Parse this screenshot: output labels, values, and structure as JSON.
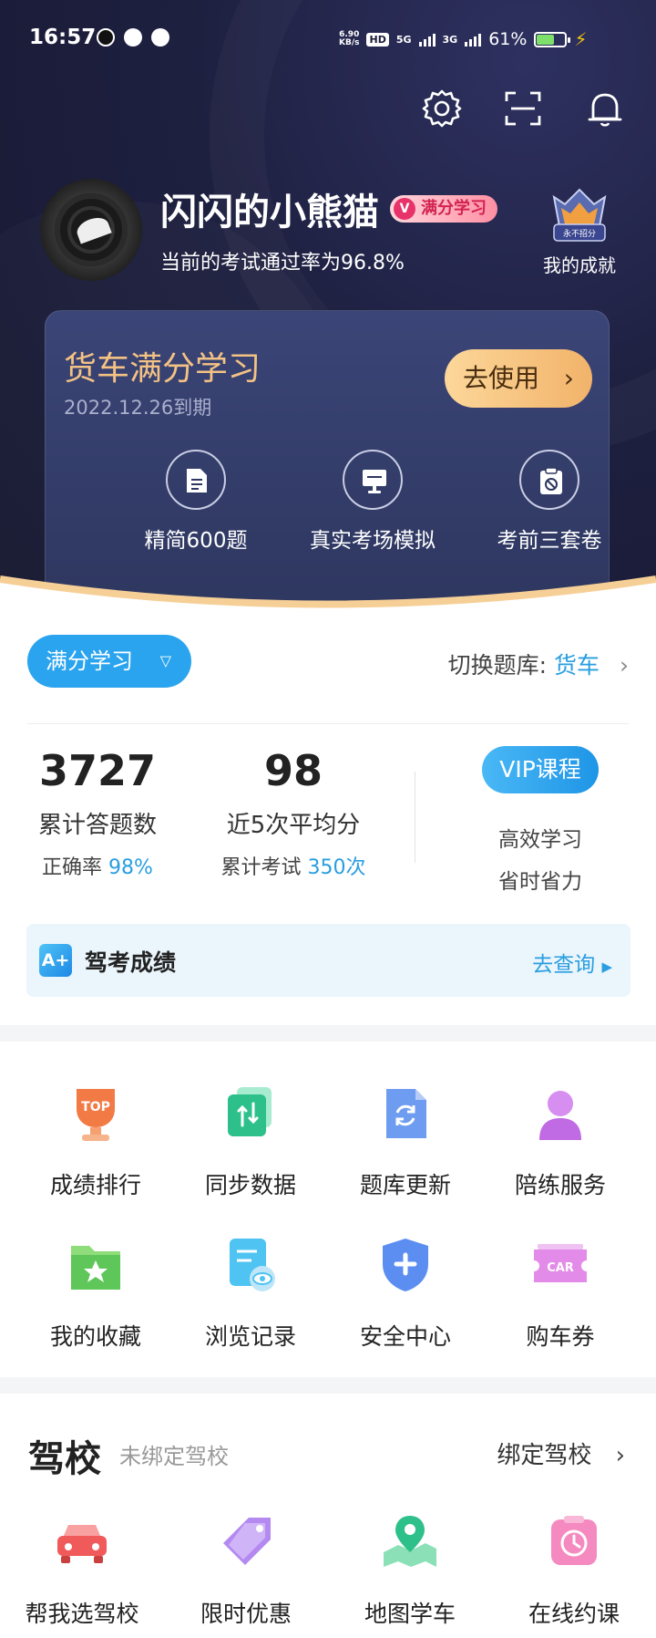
{
  "status_bar": {
    "time": "16:57",
    "net_speed": "6.90",
    "net_unit": "KB/s",
    "hd": "HD",
    "sig1": "5G",
    "sig2": "3G",
    "battery": "61%"
  },
  "header_icons": [
    "gear-icon",
    "scan-icon",
    "bell-icon"
  ],
  "profile": {
    "username": "闪闪的小熊猫",
    "badge": "满分学习",
    "pass_rate_text": "当前的考试通过率为96.8%",
    "achievement_label": "我的成就",
    "achievement_ribbon": "永不招分"
  },
  "plan_card": {
    "title": "货车满分学习",
    "expiry": "2022.12.26到期",
    "use_button": "去使用",
    "features": [
      {
        "label": "精简600题",
        "icon": "document-icon"
      },
      {
        "label": "真实考场模拟",
        "icon": "monitor-icon"
      },
      {
        "label": "考前三套卷",
        "icon": "clipboard-icon"
      }
    ]
  },
  "mode": {
    "selector": "满分学习",
    "switch_label": "切换题库:",
    "switch_value": "货车"
  },
  "stats": {
    "answered": {
      "value": "3727",
      "label": "累计答题数",
      "sub_label": "正确率",
      "sub_value": "98%"
    },
    "average": {
      "value": "98",
      "label": "近5次平均分",
      "sub_label": "累计考试",
      "sub_value": "350次"
    },
    "vip": {
      "button": "VIP课程",
      "line1": "高效学习",
      "line2": "省时省力"
    }
  },
  "results": {
    "badge": "A+",
    "label": "驾考成绩",
    "action": "去查询"
  },
  "tools": [
    {
      "label": "成绩排行",
      "icon": "trophy-icon"
    },
    {
      "label": "同步数据",
      "icon": "sync-icon"
    },
    {
      "label": "题库更新",
      "icon": "refresh-icon"
    },
    {
      "label": "陪练服务",
      "icon": "coach-icon"
    },
    {
      "label": "我的收藏",
      "icon": "star-folder-icon"
    },
    {
      "label": "浏览记录",
      "icon": "history-icon"
    },
    {
      "label": "安全中心",
      "icon": "shield-icon"
    },
    {
      "label": "购车券",
      "icon": "car-coupon-icon"
    }
  ],
  "tool_texts": {
    "top": "TOP",
    "car": "CAR"
  },
  "school": {
    "title": "驾校",
    "subtitle": "未绑定驾校",
    "bind": "绑定驾校",
    "items": [
      {
        "label": "帮我选驾校",
        "icon": "car-icon"
      },
      {
        "label": "限时优惠",
        "icon": "tag-icon"
      },
      {
        "label": "地图学车",
        "icon": "map-pin-icon"
      },
      {
        "label": "在线约课",
        "icon": "clock-icon"
      }
    ]
  },
  "colors": {
    "header_bg": "#1e2040",
    "accent_blue": "#2a9ee0",
    "gold": "#f4c284"
  }
}
